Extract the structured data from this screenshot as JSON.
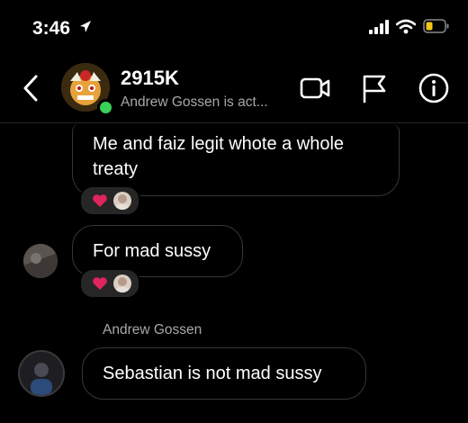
{
  "status_bar": {
    "time": "3:46"
  },
  "header": {
    "title": "2915K",
    "subtitle": "Andrew Gossen is act...",
    "icons": [
      "back-chevron-icon",
      "video-camera-icon",
      "flag-icon",
      "info-icon"
    ]
  },
  "messages": [
    {
      "text": "Me and faiz legit whote a whole treaty",
      "reactions": [
        "heart",
        "face"
      ]
    },
    {
      "text": "For mad sussy",
      "reactions": [
        "heart",
        "face"
      ]
    },
    {
      "sender": "Andrew Gossen",
      "text": "Sebastian is not mad sussy"
    }
  ],
  "colors": {
    "background": "#000000",
    "bubble_border": "#363636",
    "secondary_text": "#a8a8a8",
    "online": "#3ad05a",
    "heart": "#e0245e",
    "battery": "#f5c518"
  }
}
